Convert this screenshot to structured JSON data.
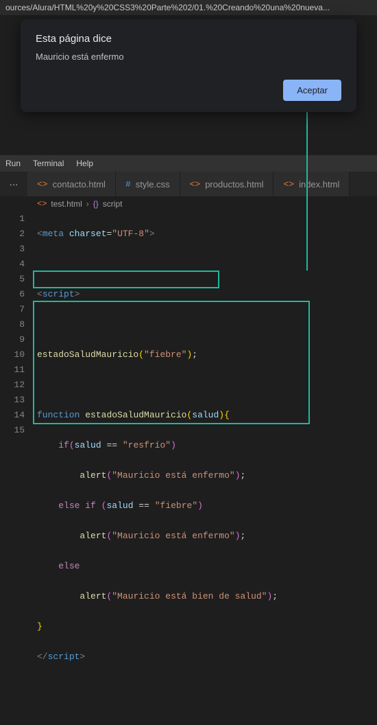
{
  "url": "ources/Alura/HTML%20y%20CSS3%20Parte%202/01.%20Creando%20una%20nueva...",
  "dialog": {
    "title": "Esta página dice",
    "message": "Mauricio está enfermo",
    "accept": "Aceptar"
  },
  "menubar": {
    "run": "Run",
    "terminal": "Terminal",
    "help": "Help"
  },
  "more": "···",
  "tabs": [
    {
      "icon": "<>",
      "label": "contacto.html"
    },
    {
      "icon": "#",
      "label": "style.css",
      "css": true
    },
    {
      "icon": "<>",
      "label": "productos.html"
    },
    {
      "icon": "<>",
      "label": "index.html"
    }
  ],
  "breadcrumb": {
    "file_icon": "<>",
    "file": "test.html",
    "sym_icon": "{}",
    "sym": "script"
  },
  "lines": [
    "1",
    "2",
    "3",
    "4",
    "5",
    "6",
    "7",
    "8",
    "9",
    "10",
    "11",
    "12",
    "13",
    "14",
    "15"
  ]
}
